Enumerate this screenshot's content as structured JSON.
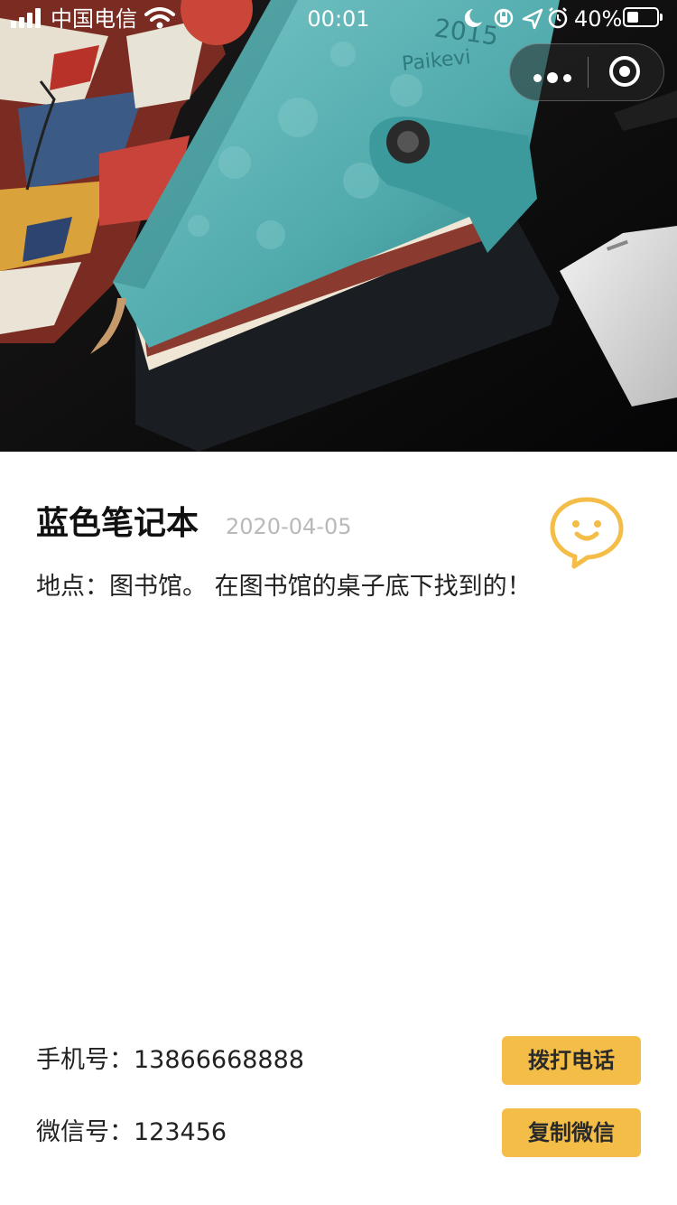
{
  "status_bar": {
    "carrier": "中国电信",
    "time": "00:01",
    "battery": "40%",
    "battery_level": 0.4
  },
  "capsule": {
    "more_icon": "more-dots-icon",
    "close_icon": "target-close-icon"
  },
  "item": {
    "title": "蓝色笔记本",
    "date": "2020-04-05",
    "description": "地点：图书馆。 在图书馆的桌子底下找到的！",
    "photo_brand_text": "Paikevi",
    "photo_year_text": "2015"
  },
  "contact": {
    "phone_line": "手机号：13866668888",
    "wechat_line": "微信号：123456",
    "call_button": "拨打电话",
    "copy_button": "复制微信"
  },
  "colors": {
    "accent": "#f3bd48",
    "notebook": "#5fb4b6"
  }
}
